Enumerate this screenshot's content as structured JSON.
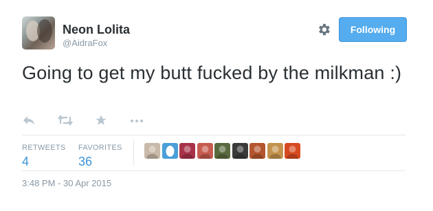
{
  "header": {
    "fullname": "Neon Lolita",
    "username": "@AidraFox",
    "follow_label": "Following"
  },
  "tweet": {
    "text": "Going to get my butt fucked by the milkman  :)"
  },
  "stats": {
    "retweets_label": "RETWEETS",
    "retweets_count": "4",
    "favorites_label": "FAVORITES",
    "favorites_count": "36"
  },
  "favoriters": [
    {
      "color": "#c9b9a8",
      "icon": "user-avatar"
    },
    {
      "color": "#4a9fd8",
      "icon": "default-egg-avatar"
    },
    {
      "color": "#a8324a",
      "icon": "user-avatar"
    },
    {
      "color": "#c65b4f",
      "icon": "user-avatar"
    },
    {
      "color": "#5a6a3f",
      "icon": "user-avatar"
    },
    {
      "color": "#3a3a3a",
      "icon": "user-avatar"
    },
    {
      "color": "#b4552e",
      "icon": "user-avatar"
    },
    {
      "color": "#c4924d",
      "icon": "user-avatar"
    },
    {
      "color": "#d64a1f",
      "icon": "user-avatar"
    }
  ],
  "timestamp": "3:48 PM - 30 Apr 2015",
  "colors": {
    "accent": "#55acee",
    "link": "#3b94d9",
    "muted": "#8899a6"
  }
}
